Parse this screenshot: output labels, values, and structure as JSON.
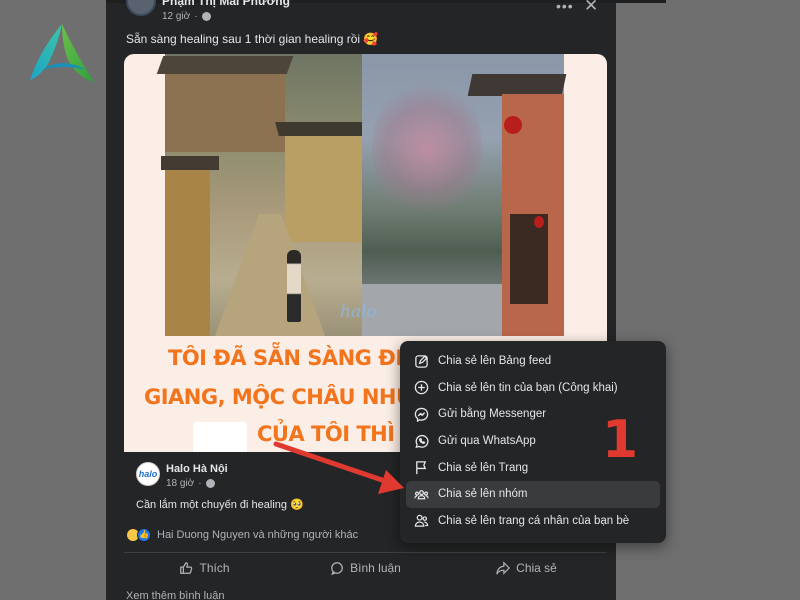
{
  "post": {
    "author": "Phạm Thị Mai Phương",
    "time": "12 giờ",
    "text": "Sẵn sàng healing sau 1 thời gian healing rồi 🥰"
  },
  "image": {
    "watermark": "halo",
    "banner_lines": [
      "TÔI ĐÃ SẴN SÀNG ĐI Đ",
      "GIANG, MỘC CHÂU NHU",
      "CỦA TÔI THÌ CH"
    ]
  },
  "shared_page": {
    "avatar_text": "halo",
    "name": "Halo Hà Nội",
    "time": "18 giờ",
    "text": "Cần lắm một chuyến đi healing 🥺"
  },
  "reactions": {
    "text": "Hai Duong Nguyen và những người khác"
  },
  "actions": {
    "like": "Thích",
    "comment": "Bình luận",
    "share": "Chia sẻ"
  },
  "more_comments": "Xem thêm bình luận",
  "share_menu": {
    "items": [
      {
        "label": "Chia sẻ lên Bảng feed",
        "icon": "edit-icon"
      },
      {
        "label": "Chia sẻ lên tin của bạn (Công khai)",
        "icon": "plus-circle-icon"
      },
      {
        "label": "Gửi bằng Messenger",
        "icon": "messenger-icon"
      },
      {
        "label": "Gửi qua WhatsApp",
        "icon": "whatsapp-icon"
      },
      {
        "label": "Chia sẻ lên Trang",
        "icon": "flag-icon"
      },
      {
        "label": "Chia sẻ lên nhóm",
        "icon": "group-icon"
      },
      {
        "label": "Chia sẻ lên trang cá nhân của bạn bè",
        "icon": "friends-icon"
      }
    ],
    "highlighted_item": "Chia sẻ lên nhóm"
  },
  "annotation": {
    "number": "1",
    "color": "#e03a30"
  },
  "colors": {
    "background": "#6f6f70",
    "panel": "#242526",
    "text_primary": "#e4e6eb",
    "text_secondary": "#b0b3b8",
    "banner_orange": "#f2741d"
  }
}
